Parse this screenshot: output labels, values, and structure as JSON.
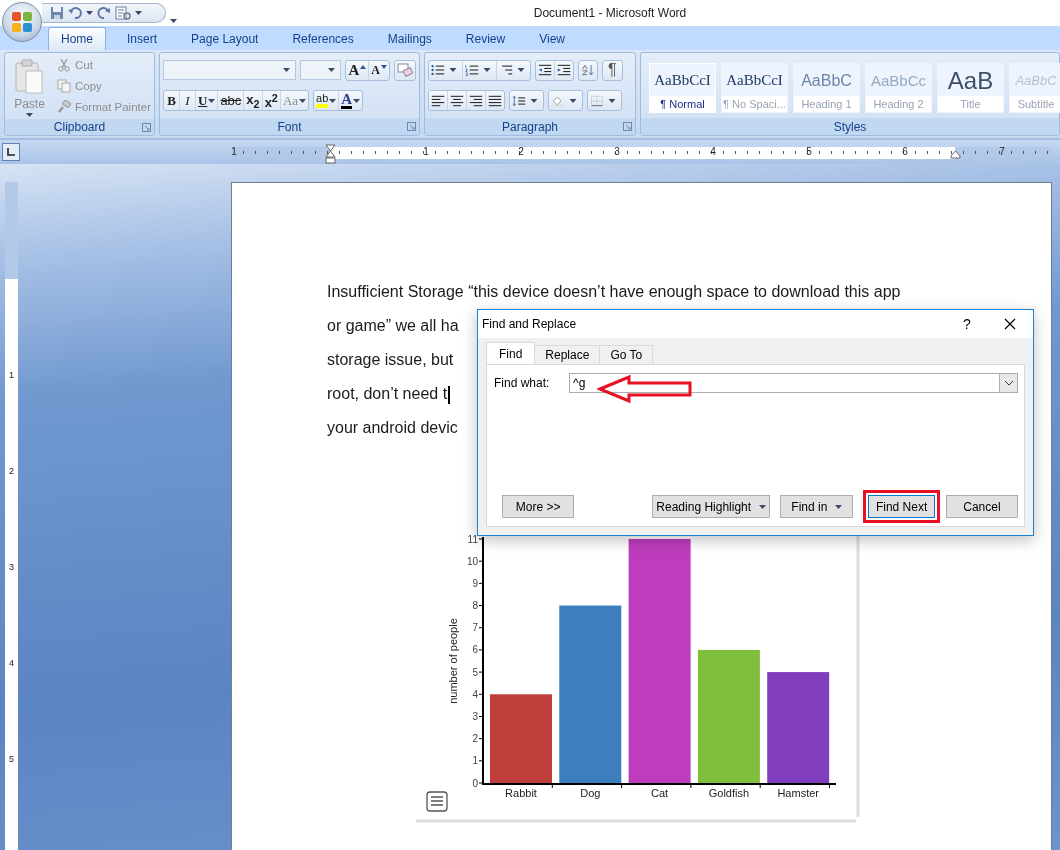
{
  "title_bar": {
    "title": "Document1 - Microsoft Word"
  },
  "ribbon_tabs": [
    {
      "label": "Home",
      "selected": true
    },
    {
      "label": "Insert",
      "selected": false
    },
    {
      "label": "Page Layout",
      "selected": false
    },
    {
      "label": "References",
      "selected": false
    },
    {
      "label": "Mailings",
      "selected": false
    },
    {
      "label": "Review",
      "selected": false
    },
    {
      "label": "View",
      "selected": false
    }
  ],
  "clipboard": {
    "label": "Clipboard",
    "paste": {
      "label": "Paste",
      "disabled": true
    },
    "items": [
      {
        "label": "Cut",
        "kind": "cut",
        "disabled": true
      },
      {
        "label": "Copy",
        "kind": "copy",
        "disabled": true
      },
      {
        "label": "Format Painter",
        "kind": "painter",
        "disabled": true
      }
    ]
  },
  "font": {
    "label": "Font",
    "grow": "A",
    "shrink": "A",
    "format_buttons": [
      {
        "text": "B",
        "kind": "bold",
        "dropdown": false,
        "disabled": false
      },
      {
        "text": "I",
        "kind": "italic",
        "dropdown": false,
        "disabled": false
      },
      {
        "text": "U",
        "kind": "underline",
        "dropdown": true,
        "disabled": false
      },
      {
        "text": "abc",
        "kind": "strike",
        "dropdown": false,
        "disabled": false
      },
      {
        "text": "x$_{2}$",
        "kind": "sub",
        "dropdown": false,
        "disabled": false
      },
      {
        "text": "x$^{2}$",
        "kind": "sup",
        "dropdown": false,
        "disabled": false
      },
      {
        "text": "Aa",
        "kind": "case",
        "dropdown": true,
        "disabled": true
      }
    ],
    "highlight": "ab",
    "font_color": "A"
  },
  "paragraph": {
    "label": "Paragraph",
    "pilcrow": "¶"
  },
  "styles": {
    "label": "Styles",
    "items": [
      {
        "sample": "AaBbCcI",
        "name": "¶ Normal",
        "kind": "normal",
        "selected": true
      },
      {
        "sample": "AaBbCcI",
        "name": "¶ No Spaci...",
        "kind": "nospacing",
        "selected": false
      },
      {
        "sample": "AaBbC",
        "name": "Heading 1",
        "kind": "heading1",
        "selected": false
      },
      {
        "sample": "AaBbCc",
        "name": "Heading 2",
        "kind": "heading2",
        "selected": false
      },
      {
        "sample": "AaB",
        "name": "Title",
        "kind": "title",
        "selected": false
      },
      {
        "sample": "AaBbC",
        "name": "Subtitle",
        "kind": "subtitle",
        "selected": false
      }
    ]
  },
  "horizontal_ruler": {
    "numbers": [
      "1",
      "1",
      "2",
      "3",
      "4",
      "5",
      "6",
      "7"
    ]
  },
  "vertical_ruler": {
    "numbers": [
      "1",
      "2",
      "3",
      "4",
      "5"
    ]
  },
  "document": {
    "lines": [
      "Insufficient Storage “this device doesn’t have enough space to download this app",
      "or game” we all ha",
      "storage issue, but",
      "root, don’t need t",
      "your android devic"
    ],
    "chart": {
      "bars": [
        {
          "color": "#c03e3c"
        },
        {
          "color": "#3d7ebf"
        },
        {
          "color": "#bd3dbd"
        },
        {
          "color": "#80bf3d"
        },
        {
          "color": "#803dbd"
        }
      ],
      "chart_data": {
        "type": "bar",
        "ylabel": "number of people",
        "categories": [
          "Rabbit",
          "Dog",
          "Cat",
          "Goldfish",
          "Hamster"
        ],
        "series": [
          {
            "values": [
              4,
              8,
              11,
              6,
              5
            ]
          }
        ],
        "ylim": [
          0,
          11
        ],
        "yticks": [
          0,
          1,
          2,
          3,
          4,
          5,
          6,
          7,
          8,
          9,
          10,
          11
        ]
      }
    }
  },
  "dialog": {
    "title": "Find and Replace",
    "help": "?",
    "tabs": [
      {
        "label": "Find",
        "selected": true
      },
      {
        "label": "Replace",
        "selected": false
      },
      {
        "label": "Go To",
        "selected": false
      }
    ],
    "find_label": "Find what:",
    "find_value": "^g",
    "buttons": [
      {
        "label": "More >>",
        "dropdown": false,
        "annotated": false
      },
      {
        "label": "Reading Highlight",
        "dropdown": true,
        "annotated": false
      },
      {
        "label": "Find in",
        "dropdown": true,
        "annotated": false
      },
      {
        "label": "Find Next",
        "dropdown": false,
        "annotated": true
      },
      {
        "label": "Cancel",
        "dropdown": false,
        "annotated": false
      }
    ]
  }
}
